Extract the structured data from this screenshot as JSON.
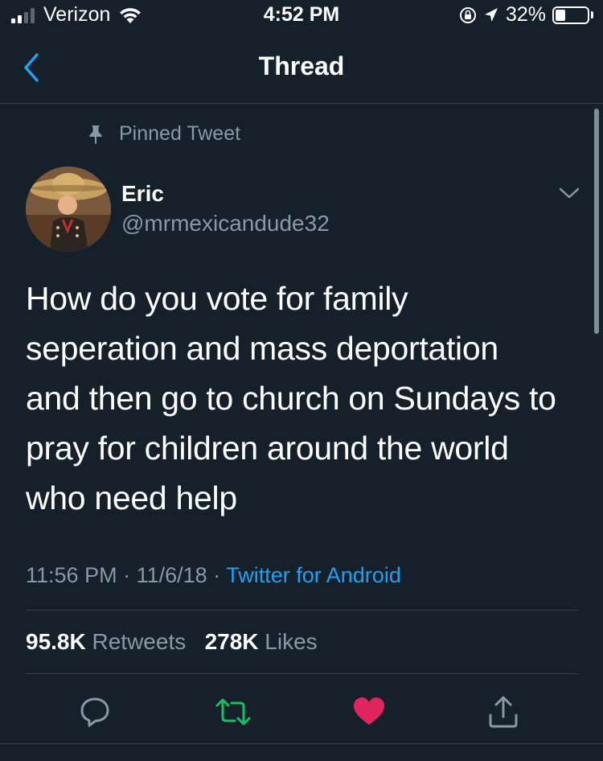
{
  "status_bar": {
    "carrier": "Verizon",
    "time": "4:52 PM",
    "battery_percent": "32%",
    "battery_level": 0.32,
    "signal_bars": 2,
    "signal_bars_total": 4,
    "icons": [
      "signal-icon",
      "wifi-icon",
      "orientation-lock-icon",
      "location-icon",
      "battery-icon"
    ]
  },
  "nav": {
    "title": "Thread",
    "back_icon": "chevron-left-icon"
  },
  "pinned": {
    "label": "Pinned Tweet",
    "icon": "pin-icon"
  },
  "author": {
    "name": "Eric",
    "handle": "@mrmexicandude32",
    "menu_icon": "chevron-down-icon"
  },
  "tweet": {
    "lines": [
      "How do you vote for family",
      "seperation and mass deportation",
      "and then go to church on Sundays to",
      "pray for children around the world",
      "who need help"
    ],
    "time": "11:56 PM",
    "date": "11/6/18",
    "separator": "·",
    "source": "Twitter for Android"
  },
  "stats": {
    "retweets_count": "95.8K",
    "retweets_label": "Retweets",
    "likes_count": "278K",
    "likes_label": "Likes"
  },
  "actions": [
    {
      "name": "reply-icon",
      "color": "#8899a6"
    },
    {
      "name": "retweet-icon",
      "color": "#17bf63"
    },
    {
      "name": "like-icon",
      "color": "#e0245e",
      "active": true
    },
    {
      "name": "share-icon",
      "color": "#8899a6"
    }
  ],
  "colors": {
    "background": "#15202b",
    "divider": "#38444d",
    "secondary_text": "#8899a6",
    "link": "#1da1f2",
    "retweet": "#17bf63",
    "like": "#e0245e"
  }
}
